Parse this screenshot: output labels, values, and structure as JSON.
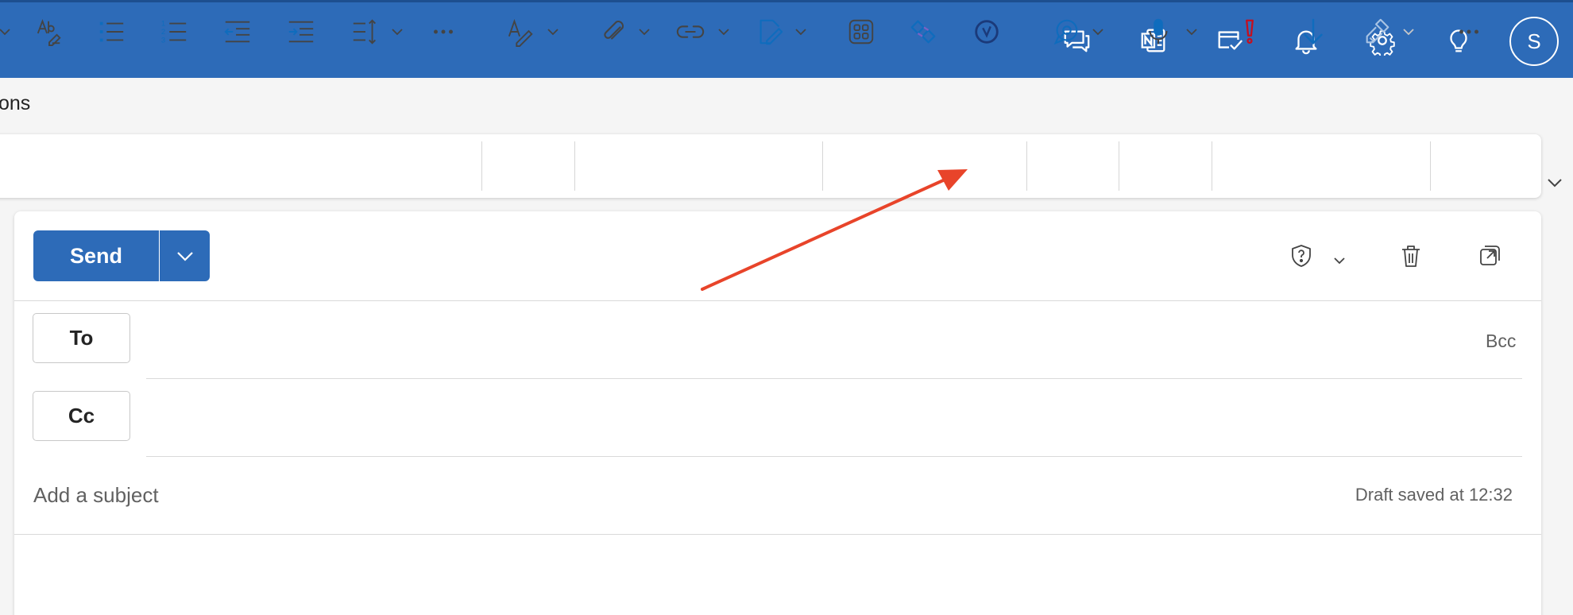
{
  "header": {
    "colors": {
      "brand": "#2d6bb8",
      "white": "#ffffff"
    },
    "icons": [
      "chat-icon",
      "onenote-icon",
      "to-do-icon",
      "bell-icon",
      "gear-icon",
      "lightbulb-icon"
    ],
    "avatar_initial": "S"
  },
  "ribbon": {
    "tab_label_partial": "ons",
    "icons": [
      "spelling-icon",
      "bullets-icon",
      "numbering-icon",
      "decrease-indent-icon",
      "increase-indent-icon",
      "line-spacing-icon",
      "more-icon",
      "editor-icon",
      "attach-icon",
      "link-icon",
      "signature-icon",
      "apps-icon",
      "loop-icon",
      "viva-icon",
      "feedback-icon",
      "dictate-icon",
      "high-importance-icon",
      "low-importance-icon",
      "format-painter-icon",
      "more-options-icon"
    ],
    "colors": {
      "importance_high": "#c50f1f",
      "accent": "#0f6cbd",
      "viva": "#1b3a7a"
    }
  },
  "compose": {
    "send_label": "Send",
    "to_label": "To",
    "cc_label": "Cc",
    "bcc_label": "Bcc",
    "subject_placeholder": "Add a subject",
    "draft_status": "Draft saved at 12:32"
  },
  "annotation": {
    "type": "red-arrow",
    "color": "#e8442a",
    "points_to": "viva-icon"
  }
}
